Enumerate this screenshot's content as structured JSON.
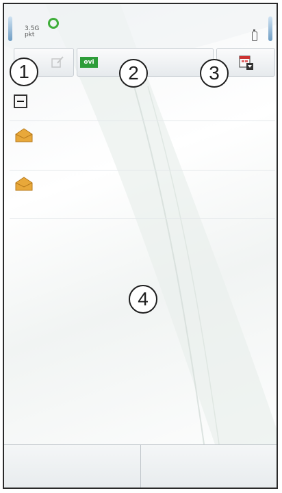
{
  "status_bar": {
    "signal_label": "3.5G",
    "signal_sub": "pkt",
    "ring_icon": "green-ring-icon",
    "battery_icon": "battery-icon"
  },
  "toolbar": {
    "new_message_icon": "new-message-icon",
    "ovi_label": "ovi",
    "calendar_icon": "calendar-icon"
  },
  "callouts": [
    "1",
    "2",
    "3",
    "4"
  ],
  "list": {
    "collapse_icon": "collapse-minus-icon",
    "items": [
      {
        "icon": "mail-envelope-icon"
      },
      {
        "icon": "mail-envelope-icon"
      }
    ]
  },
  "colors": {
    "accent_green": "#2e9d3a",
    "ring_green": "#3fae3a",
    "mail_orange": "#e8a83a",
    "edge_blue": "#6f9dc4"
  }
}
